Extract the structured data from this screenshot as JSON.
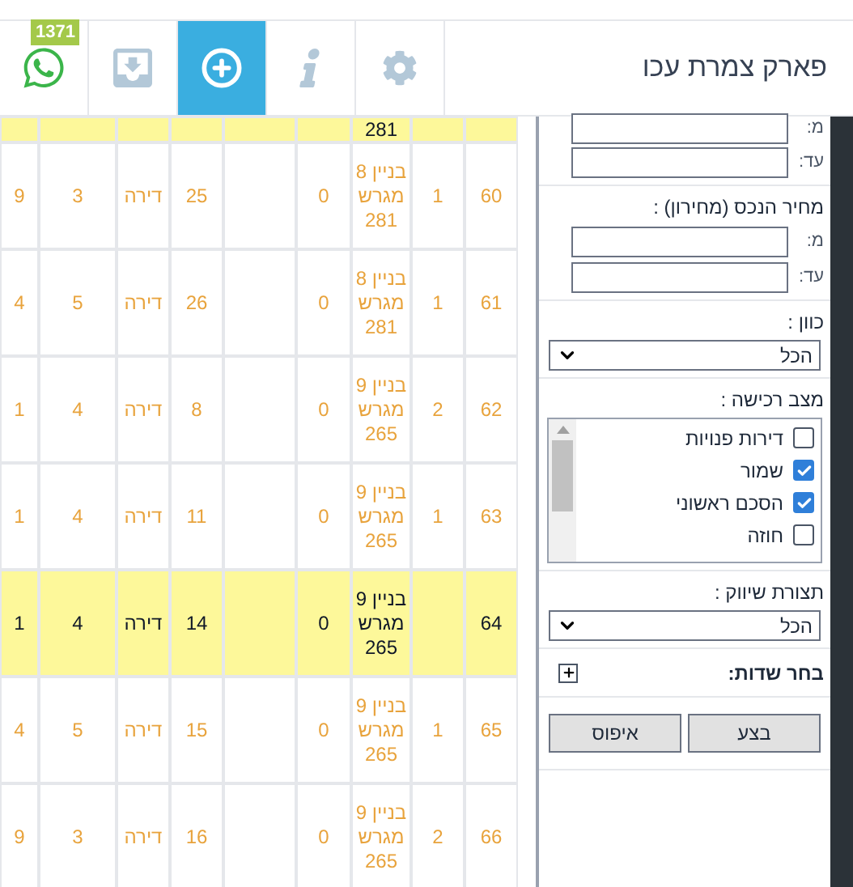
{
  "header": {
    "title": "פארק צמרת עכו",
    "badge": "1371",
    "tabs": [
      {
        "kind": "whatsapp",
        "selected": false
      },
      {
        "kind": "inbox",
        "selected": false
      },
      {
        "kind": "add",
        "selected": true
      },
      {
        "kind": "info",
        "selected": false
      },
      {
        "kind": "settings",
        "selected": false
      }
    ]
  },
  "table": {
    "rows": [
      {
        "partial": true,
        "highlighted": true,
        "cells": [
          null,
          null,
          "281",
          null,
          null,
          null,
          null,
          null,
          null
        ]
      },
      {
        "highlighted": false,
        "cells": [
          "60",
          "1",
          "בניין 8 מגרש 281",
          "0",
          null,
          "25",
          "דירה",
          "3",
          "9"
        ]
      },
      {
        "highlighted": false,
        "cells": [
          "61",
          "1",
          "בניין 8 מגרש 281",
          "0",
          null,
          "26",
          "דירה",
          "5",
          "4"
        ]
      },
      {
        "highlighted": false,
        "cells": [
          "62",
          "2",
          "בניין 9 מגרש 265",
          "0",
          null,
          "8",
          "דירה",
          "4",
          "1"
        ]
      },
      {
        "highlighted": false,
        "cells": [
          "63",
          "1",
          "בניין 9 מגרש 265",
          "0",
          null,
          "11",
          "דירה",
          "4",
          "1"
        ]
      },
      {
        "highlighted": true,
        "cells": [
          "64",
          null,
          "בניין 9 מגרש 265",
          "0",
          null,
          "14",
          "דירה",
          "4",
          "1"
        ]
      },
      {
        "highlighted": false,
        "cells": [
          "65",
          "1",
          "בניין 9 מגרש 265",
          "0",
          null,
          "15",
          "דירה",
          "5",
          "4"
        ]
      },
      {
        "highlighted": false,
        "cells": [
          "66",
          "2",
          "בניין 9 מגרש 265",
          "0",
          null,
          "16",
          "דירה",
          "3",
          "9"
        ]
      }
    ]
  },
  "filters": {
    "area_range": {
      "from_label": "מ:",
      "to_label": "עד:"
    },
    "price_range": {
      "label": "מחיר הנכס (מחירון) :",
      "from_label": "מ:",
      "to_label": "עד:"
    },
    "direction": {
      "label": "כוון :",
      "value": "הכל"
    },
    "purchase_status": {
      "label": "מצב רכישה :",
      "options": [
        {
          "label": "דירות פנויות",
          "checked": false
        },
        {
          "label": "שמור",
          "checked": true
        },
        {
          "label": "הסכם ראשוני",
          "checked": true
        },
        {
          "label": "חוזה",
          "checked": false
        }
      ]
    },
    "marketing": {
      "label": "תצורת שיווק :",
      "value": "הכל"
    },
    "fields": {
      "label": "בחר שדות:"
    },
    "buttons": [
      "בצע",
      "איפוס"
    ]
  }
}
